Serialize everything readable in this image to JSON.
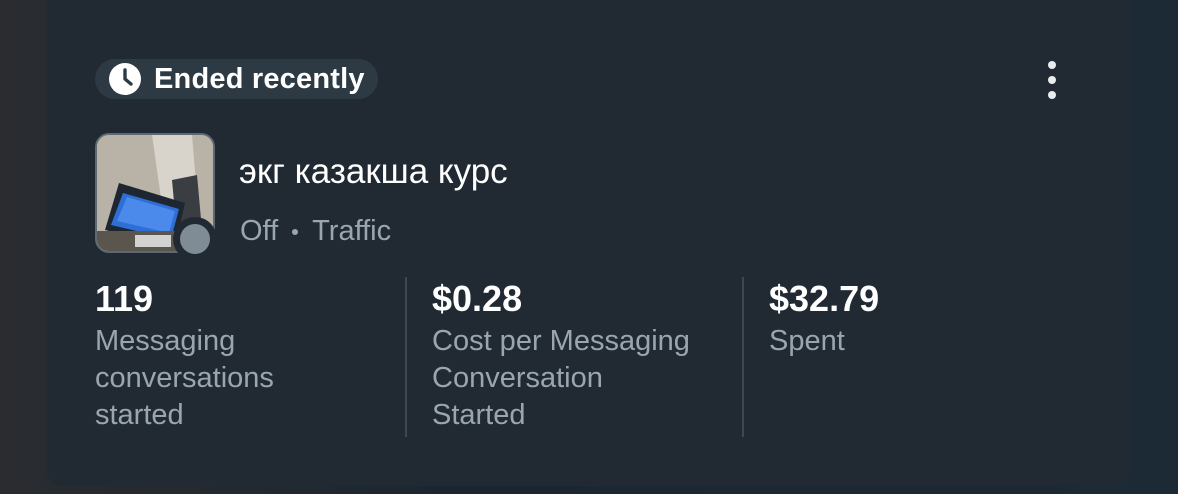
{
  "status": {
    "label": "Ended recently",
    "icon": "clock-icon"
  },
  "menu": {
    "icon": "more-vertical-icon"
  },
  "ad": {
    "name": "экг казакша курс",
    "delivery": "Off",
    "objective": "Traffic",
    "delivery_dot_color": "#7f8c96"
  },
  "metrics": [
    {
      "value": "119",
      "label": "Messaging\nconversations\nstarted"
    },
    {
      "value": "$0.28",
      "label": "Cost per Messaging\nConversation\nStarted"
    },
    {
      "value": "$32.79",
      "label": "Spent"
    }
  ],
  "colors": {
    "card_bg": "#212a33",
    "pill_bg": "#2d3a44",
    "text_primary": "#ffffff",
    "text_secondary": "#9aa6ae"
  }
}
